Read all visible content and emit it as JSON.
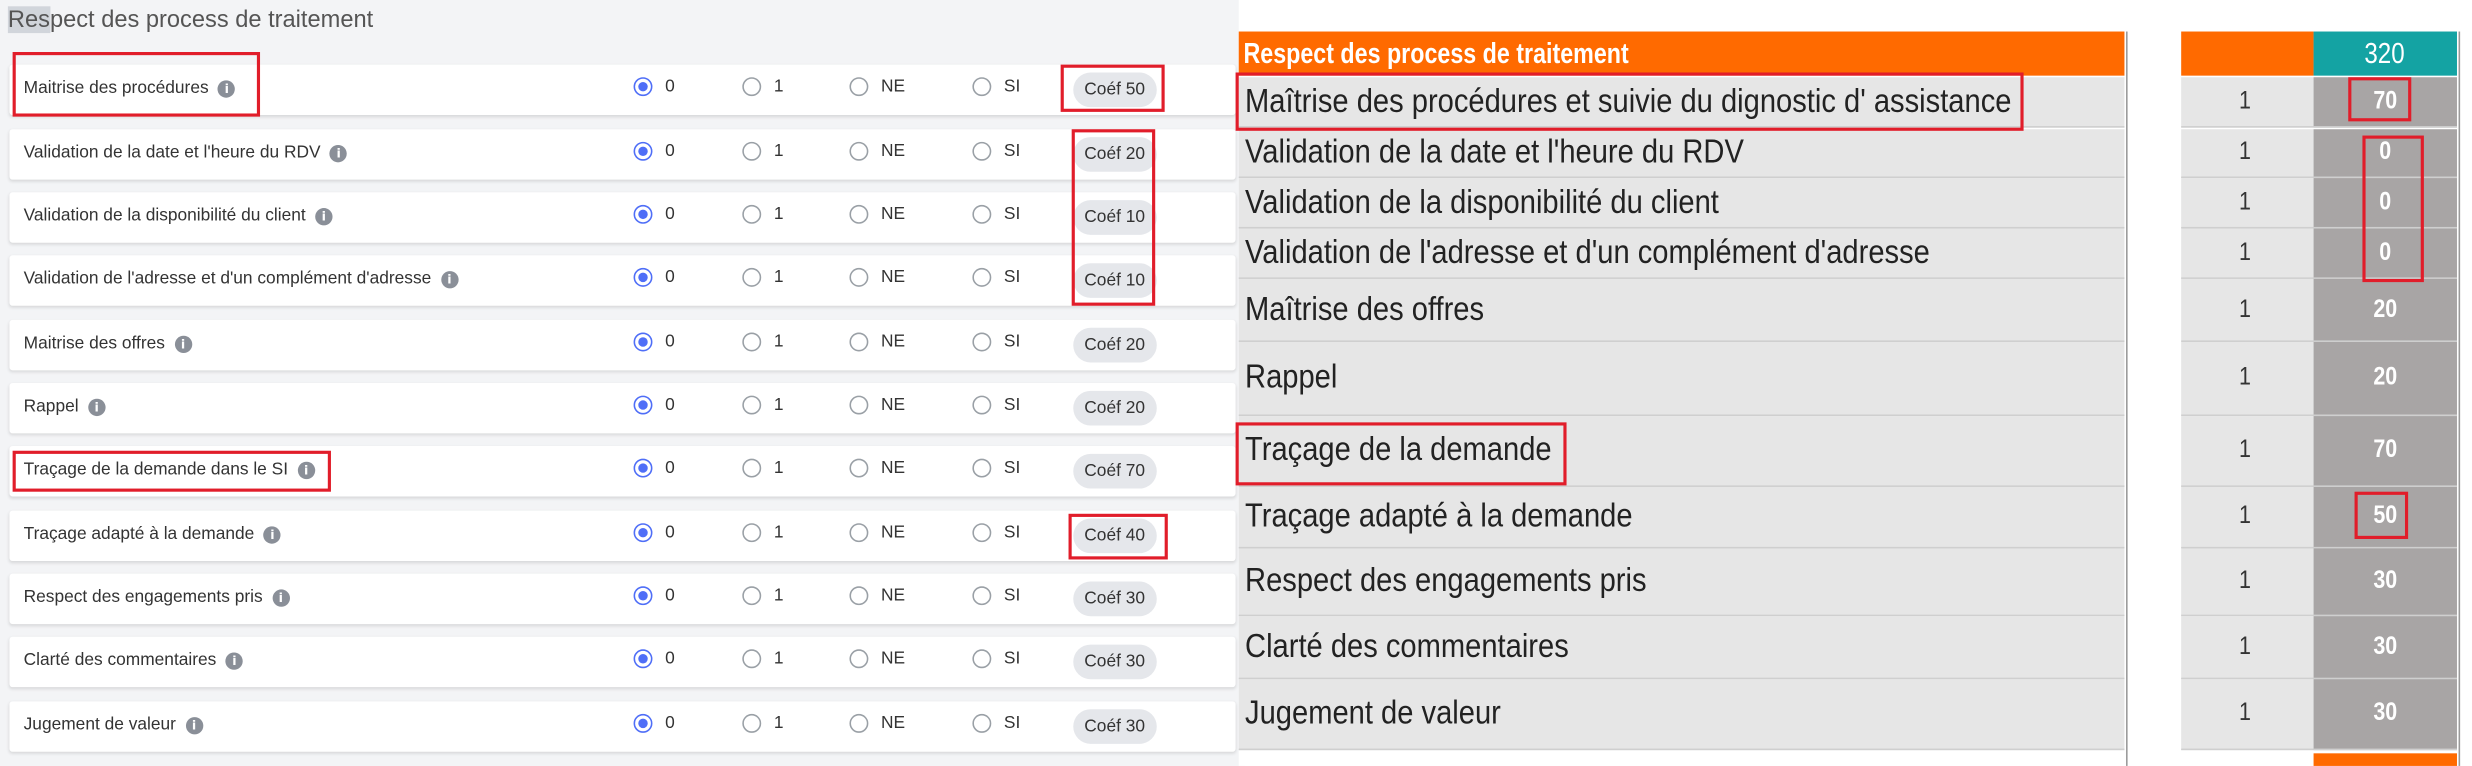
{
  "left_panel": {
    "title_highlight": "Res",
    "title_rest": "pect des process de traitement",
    "options": [
      "0",
      "1",
      "NE",
      "SI"
    ],
    "rows": [
      {
        "label": "Maitrise des procédures",
        "selected": "0",
        "coef": "Coéf 50"
      },
      {
        "label": "Validation de la date et l'heure du RDV",
        "selected": "0",
        "coef": "Coéf 20"
      },
      {
        "label": "Validation de la disponibilité du client",
        "selected": "0",
        "coef": "Coéf 10"
      },
      {
        "label": "Validation de l'adresse et d'un complément d'adresse",
        "selected": "0",
        "coef": "Coéf 10"
      },
      {
        "label": "Maitrise des offres",
        "selected": "0",
        "coef": "Coéf 20"
      },
      {
        "label": "Rappel",
        "selected": "0",
        "coef": "Coéf 20"
      },
      {
        "label": "Traçage de la demande dans le SI",
        "selected": "0",
        "coef": "Coéf 70"
      },
      {
        "label": "Traçage adapté à la demande",
        "selected": "0",
        "coef": "Coéf 40"
      },
      {
        "label": "Respect des engagements pris",
        "selected": "0",
        "coef": "Coéf 30"
      },
      {
        "label": "Clarté des commentaires",
        "selected": "0",
        "coef": "Coéf 30"
      },
      {
        "label": "Jugement de valeur",
        "selected": "0",
        "coef": "Coéf 30"
      }
    ]
  },
  "right_panel": {
    "header_label": "Respect des process de traitement",
    "header_total": "320",
    "rows": [
      {
        "label": "Maîtrise des procédures et suivie du dignostic d' assistance",
        "count": "1",
        "score": "70"
      },
      {
        "label": "Validation de la date et l'heure du RDV",
        "count": "1",
        "score": "0"
      },
      {
        "label": "Validation de la disponibilité du client",
        "count": "1",
        "score": "0"
      },
      {
        "label": "Validation de l'adresse et d'un complément d'adresse",
        "count": "1",
        "score": "0"
      },
      {
        "label": "Maîtrise des offres",
        "count": "1",
        "score": "20"
      },
      {
        "label": "Rappel",
        "count": "1",
        "score": "20"
      },
      {
        "label": "Traçage de la demande",
        "count": "1",
        "score": "70"
      },
      {
        "label": "Traçage adapté à la demande",
        "count": "1",
        "score": "50"
      },
      {
        "label": "Respect des engagements pris",
        "count": "1",
        "score": "30"
      },
      {
        "label": "Clarté des commentaires",
        "count": "1",
        "score": "30"
      },
      {
        "label": "Jugement de valeur",
        "count": "1",
        "score": "30"
      }
    ]
  },
  "colors": {
    "accent_radio": "#4f6ef7",
    "header_orange": "#ff6a00",
    "header_teal": "#14a3a3",
    "annotation_red": "#e11d2a"
  }
}
